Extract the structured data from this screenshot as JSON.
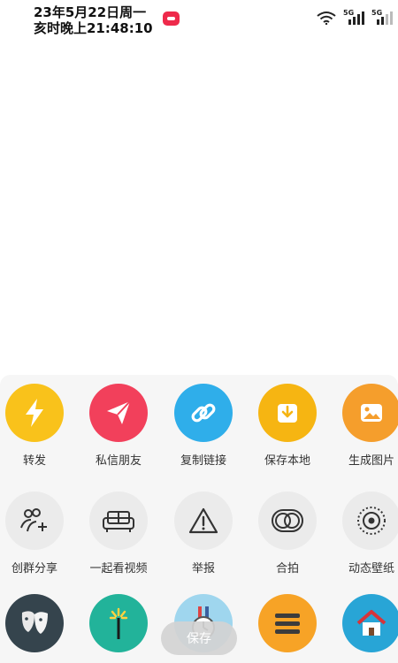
{
  "status_bar": {
    "line1": "23年5月22日周一",
    "line2": "亥时晚上21:48:10",
    "network_labels": [
      "5G",
      "5G"
    ]
  },
  "share_row_1": [
    {
      "label": "转发",
      "icon": "lightning-icon",
      "color": "#f9c21b"
    },
    {
      "label": "私信朋友",
      "icon": "paper-plane-icon",
      "color": "#f2405b"
    },
    {
      "label": "复制链接",
      "icon": "link-icon",
      "color": "#2faeea"
    },
    {
      "label": "保存本地",
      "icon": "download-icon",
      "color": "#f6b512"
    },
    {
      "label": "生成图片",
      "icon": "image-icon",
      "color": "#f59e2c"
    }
  ],
  "share_row_2": [
    {
      "label": "创群分享",
      "icon": "group-add-icon"
    },
    {
      "label": "一起看视频",
      "icon": "sofa-icon"
    },
    {
      "label": "举报",
      "icon": "warning-icon"
    },
    {
      "label": "合拍",
      "icon": "duet-icon"
    },
    {
      "label": "动态壁纸",
      "icon": "wallpaper-icon"
    }
  ],
  "share_row_3_icons": [
    "mask-icon",
    "sparkler-icon",
    "clock-icon",
    "list-icon",
    "home-icon"
  ],
  "toast": {
    "label": "保存"
  }
}
